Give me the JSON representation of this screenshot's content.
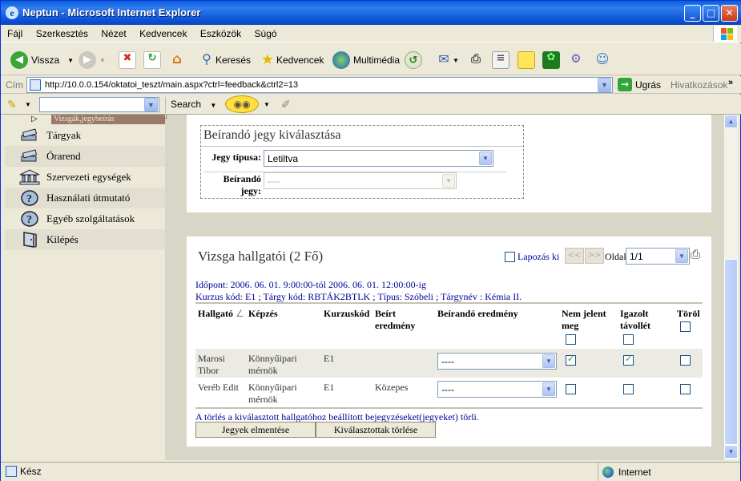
{
  "window": {
    "title": "Neptun - Microsoft Internet Explorer"
  },
  "menu": [
    "Fájl",
    "Szerkesztés",
    "Nézet",
    "Kedvencek",
    "Eszközök",
    "Súgó"
  ],
  "toolbar": {
    "back_label": "Vissza",
    "search_label": "Keresés",
    "favorites_label": "Kedvencek",
    "multimedia_label": "Multimédia"
  },
  "address": {
    "label": "Cím",
    "url": "http://10.0.0.154/oktatoi_teszt/main.aspx?ctrl=feedback&ctrl2=13",
    "go_label": "Ugrás",
    "links_label": "Hivatkozások"
  },
  "searchbar": {
    "search_label": "Search"
  },
  "sidebar": {
    "current": "Vizsgák,jegybeírás",
    "items": [
      {
        "label": "Tárgyak",
        "icon": "books-icon"
      },
      {
        "label": "Órarend",
        "icon": "books-icon"
      },
      {
        "label": "Szervezeti egységek",
        "icon": "building-icon"
      },
      {
        "label": "Használati útmutató",
        "icon": "help-icon"
      },
      {
        "label": "Egyéb szolgáltatások",
        "icon": "help-icon"
      },
      {
        "label": "Kilépés",
        "icon": "door-icon"
      }
    ]
  },
  "grade_select": {
    "title": "Beírandó jegy kiválasztása",
    "type_label": "Jegy típusa:",
    "type_value": "Letiltva",
    "grade_label_1": "Beírandó",
    "grade_label_2": "jegy:",
    "grade_value": "----"
  },
  "exam_students": {
    "title": "Vizsga hallgatói (2 Fő)",
    "paging_label": "Lapozás ki",
    "prev_label": "<<",
    "next_label": ">>",
    "page_label": "Oldal",
    "page_value": "1/1",
    "info_line1": "Időpont: 2006. 06. 01. 9:00:00-tól 2006. 06. 01. 12:00:00-ig",
    "info_line2": "Kurzus kód: E1 ; Tárgy kód: RBTÁK2BTLK ; Típus: Szóbeli ; Tárgynév : Kémia II.",
    "columns": {
      "student": "Hallgató",
      "sort_mark": "∠",
      "training": "Képzés",
      "course_code": "Kurzuskód",
      "entered_1": "Beírt",
      "entered_2": "eredmény",
      "to_enter": "Beírandó eredmény",
      "absent_1": "Nem jelent",
      "absent_2": "meg",
      "excused_1": "Igazolt",
      "excused_2": "távollét",
      "delete": "Töröl"
    },
    "rows": [
      {
        "name_1": "Marosi",
        "name_2": "Tibor",
        "training_1": "Könnyűipari",
        "training_2": "mérnök",
        "course_code": "E1",
        "entered": "",
        "to_enter": "----",
        "absent": true,
        "excused": true,
        "delete": false
      },
      {
        "name_1": "Veréb Edit",
        "name_2": "",
        "training_1": "Könnyűipari",
        "training_2": "mérnök",
        "course_code": "E1",
        "entered": "Közepes",
        "to_enter": "----",
        "absent": false,
        "excused": false,
        "delete": false
      }
    ],
    "note": "A törlés a kiválasztott hallgatóhoz beállított bejegyzéseket(jegyeket) törli.",
    "save_label": "Jegyek elmentése",
    "delete_selected_label": "Kiválasztottak törlése"
  },
  "status": {
    "text": "Kész",
    "zone": "Internet"
  }
}
